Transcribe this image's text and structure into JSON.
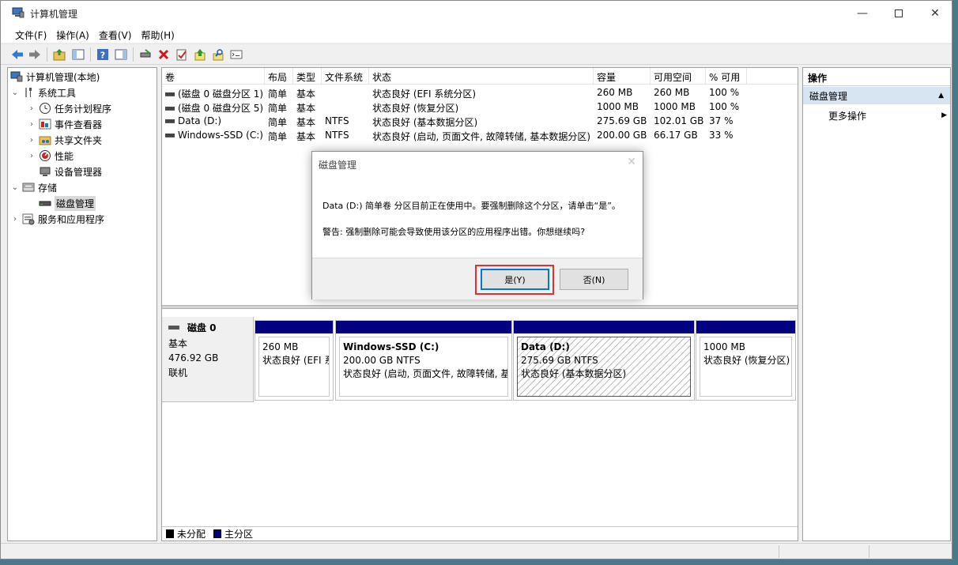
{
  "window": {
    "title": "计算机管理"
  },
  "menu": [
    "文件(F)",
    "操作(A)",
    "查看(V)",
    "帮助(H)"
  ],
  "tree": {
    "root": "计算机管理(本地)",
    "system_tools": "系统工具",
    "task_scheduler": "任务计划程序",
    "event_viewer": "事件查看器",
    "shared_folders": "共享文件夹",
    "performance": "性能",
    "device_manager": "设备管理器",
    "storage": "存储",
    "disk_management": "磁盘管理",
    "services": "服务和应用程序"
  },
  "volumes": {
    "columns": [
      "卷",
      "布局",
      "类型",
      "文件系统",
      "状态",
      "容量",
      "可用空间",
      "% 可用"
    ],
    "rows": [
      [
        "(磁盘 0 磁盘分区 1)",
        "简单",
        "基本",
        "",
        "状态良好 (EFI 系统分区)",
        "260 MB",
        "260 MB",
        "100 %"
      ],
      [
        "(磁盘 0 磁盘分区 5)",
        "简单",
        "基本",
        "",
        "状态良好 (恢复分区)",
        "1000 MB",
        "1000 MB",
        "100 %"
      ],
      [
        "Data (D:)",
        "简单",
        "基本",
        "NTFS",
        "状态良好 (基本数据分区)",
        "275.69 GB",
        "102.01 GB",
        "37 %"
      ],
      [
        "Windows-SSD (C:)",
        "简单",
        "基本",
        "NTFS",
        "状态良好 (启动, 页面文件, 故障转储, 基本数据分区)",
        "200.00 GB",
        "66.17 GB",
        "33 %"
      ]
    ]
  },
  "disk": {
    "name": "磁盘 0",
    "type": "基本",
    "size": "476.92 GB",
    "status": "联机",
    "partitions": [
      {
        "name": "",
        "size": "260 MB",
        "status": "状态良好 (EFI 系"
      },
      {
        "name": "Windows-SSD  (C:)",
        "size": "200.00 GB NTFS",
        "status": "状态良好 (启动, 页面文件, 故障转储, 基"
      },
      {
        "name": "Data  (D:)",
        "size": "275.69 GB NTFS",
        "status": "状态良好 (基本数据分区)"
      },
      {
        "name": "",
        "size": "1000 MB",
        "status": "状态良好 (恢复分区)"
      }
    ]
  },
  "legend": {
    "unallocated": "未分配",
    "primary": "主分区"
  },
  "actions": {
    "header": "操作",
    "section": "磁盘管理",
    "more": "更多操作"
  },
  "dialog": {
    "title": "磁盘管理",
    "message": "Data (D:) 简单卷 分区目前正在使用中。要强制删除这个分区，请单击“是”。",
    "warning": "警告: 强制删除可能会导致使用该分区的应用程序出错。你想继续吗?",
    "yes": "是(Y)",
    "no": "否(N)"
  },
  "colors": {
    "primary_partition": "#000080",
    "highlight": "#e03030",
    "action_section": "#d7e4f2"
  }
}
